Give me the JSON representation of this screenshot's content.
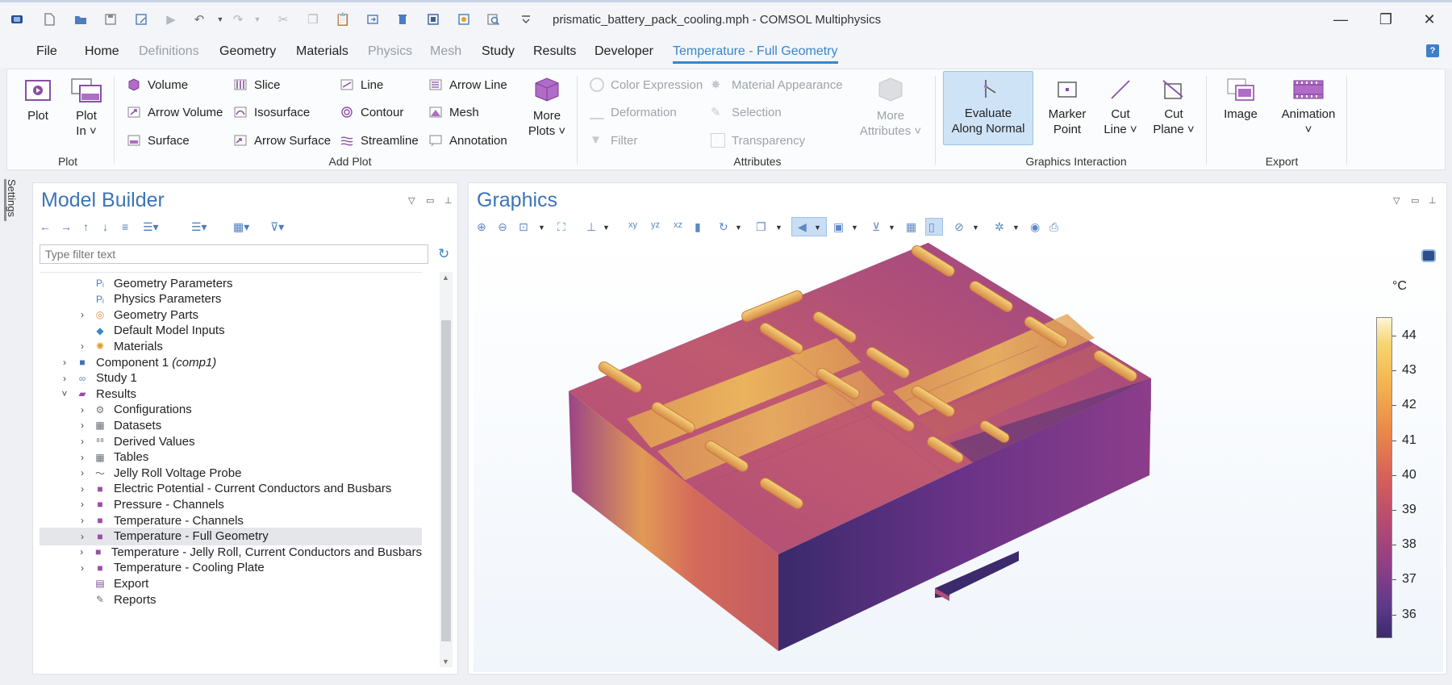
{
  "titlebar": {
    "title": "prismatic_battery_pack_cooling.mph - COMSOL Multiphysics",
    "quick_access": [
      "app-icon",
      "new-icon",
      "open-icon",
      "save-icon",
      "save-as-icon",
      "run-icon",
      "undo-icon",
      "redo-icon",
      "cut-icon",
      "copy-icon",
      "paste-icon",
      "duplicate-icon",
      "delete-icon",
      "select-icon",
      "wizard-icon",
      "find-icon",
      "customize-icon"
    ]
  },
  "menu": {
    "items": [
      {
        "label": "File",
        "state": "normal"
      },
      {
        "label": "Home",
        "state": "normal"
      },
      {
        "label": "Definitions",
        "state": "dim"
      },
      {
        "label": "Geometry",
        "state": "normal"
      },
      {
        "label": "Materials",
        "state": "normal"
      },
      {
        "label": "Physics",
        "state": "dim"
      },
      {
        "label": "Mesh",
        "state": "dim"
      },
      {
        "label": "Study",
        "state": "normal"
      },
      {
        "label": "Results",
        "state": "normal"
      },
      {
        "label": "Developer",
        "state": "normal"
      },
      {
        "label": "Temperature - Full Geometry",
        "state": "active"
      }
    ],
    "help": "?"
  },
  "ribbon": {
    "plot_group": {
      "label": "Plot",
      "plot": "Plot",
      "plot_in_1": "Plot",
      "plot_in_2": "In ˅"
    },
    "add_plot": {
      "label": "Add Plot",
      "col1": [
        "Volume",
        "Arrow Volume",
        "Surface"
      ],
      "col2": [
        "Slice",
        "Isosurface",
        "Arrow Surface"
      ],
      "col3": [
        "Line",
        "Contour",
        "Streamline"
      ],
      "col4": [
        "Arrow Line",
        "Mesh",
        "Annotation"
      ],
      "more_1": "More",
      "more_2": "Plots ˅"
    },
    "attributes": {
      "label": "Attributes",
      "col1": [
        "Color Expression",
        "Deformation",
        "Filter"
      ],
      "col2": [
        "Material Appearance",
        "Selection",
        "Transparency"
      ],
      "more_1": "More",
      "more_2": "Attributes ˅"
    },
    "graphics_interaction": {
      "label": "Graphics Interaction",
      "eval_1": "Evaluate",
      "eval_2": "Along Normal",
      "marker_1": "Marker",
      "marker_2": "Point",
      "cutline_1": "Cut",
      "cutline_2": "Line ˅",
      "cutplane_1": "Cut",
      "cutplane_2": "Plane ˅"
    },
    "export": {
      "label": "Export",
      "image": "Image",
      "animation": "Animation",
      "animation_caret": "˅"
    }
  },
  "settings_tab": "Settings",
  "model_builder": {
    "title": "Model Builder",
    "filter_placeholder": "Type filter text",
    "tree": [
      {
        "label": "Geometry Parameters",
        "italic": "",
        "level": 2,
        "expander": "",
        "icon": "parameters-icon",
        "selected": false
      },
      {
        "label": "Physics Parameters",
        "italic": "",
        "level": 2,
        "expander": "",
        "icon": "parameters-icon",
        "selected": false
      },
      {
        "label": "Geometry Parts",
        "italic": "",
        "level": 2,
        "expander": "›",
        "icon": "geometry-parts-icon",
        "selected": false
      },
      {
        "label": "Default Model Inputs",
        "italic": "",
        "level": 2,
        "expander": "",
        "icon": "model-inputs-icon",
        "selected": false
      },
      {
        "label": "Materials",
        "italic": "",
        "level": 2,
        "expander": "›",
        "icon": "materials-icon",
        "selected": false
      },
      {
        "label": "Component 1 ",
        "italic": "(comp1)",
        "level": 1,
        "expander": "›",
        "icon": "component-icon",
        "selected": false
      },
      {
        "label": "Study 1",
        "italic": "",
        "level": 1,
        "expander": "›",
        "icon": "study-icon",
        "selected": false
      },
      {
        "label": "Results",
        "italic": "",
        "level": 1,
        "expander": "˅",
        "icon": "results-icon",
        "selected": false
      },
      {
        "label": "Configurations",
        "italic": "",
        "level": 2,
        "expander": "›",
        "icon": "configurations-icon",
        "selected": false
      },
      {
        "label": "Datasets",
        "italic": "",
        "level": 2,
        "expander": "›",
        "icon": "datasets-icon",
        "selected": false
      },
      {
        "label": "Derived Values",
        "italic": "",
        "level": 2,
        "expander": "›",
        "icon": "derived-values-icon",
        "selected": false
      },
      {
        "label": "Tables",
        "italic": "",
        "level": 2,
        "expander": "›",
        "icon": "tables-icon",
        "selected": false
      },
      {
        "label": "Jelly Roll Voltage Probe",
        "italic": "",
        "level": 2,
        "expander": "›",
        "icon": "probe-plot-icon",
        "selected": false
      },
      {
        "label": "Electric Potential - Current Conductors and Busbars",
        "italic": "",
        "level": 2,
        "expander": "›",
        "icon": "plot-group-3d-icon",
        "selected": false
      },
      {
        "label": "Pressure - Channels",
        "italic": "",
        "level": 2,
        "expander": "›",
        "icon": "plot-group-3d-icon",
        "selected": false
      },
      {
        "label": "Temperature - Channels",
        "italic": "",
        "level": 2,
        "expander": "›",
        "icon": "plot-group-3d-icon",
        "selected": false
      },
      {
        "label": "Temperature - Full Geometry",
        "italic": "",
        "level": 2,
        "expander": "›",
        "icon": "plot-group-3d-icon",
        "selected": true
      },
      {
        "label": "Temperature - Jelly Roll, Current Conductors and Busbars",
        "italic": "",
        "level": 2,
        "expander": "›",
        "icon": "plot-group-3d-icon",
        "selected": false
      },
      {
        "label": "Temperature - Cooling Plate",
        "italic": "",
        "level": 2,
        "expander": "›",
        "icon": "plot-group-3d-icon",
        "selected": false
      },
      {
        "label": "Export",
        "italic": "",
        "level": 2,
        "expander": "",
        "icon": "export-icon",
        "selected": false
      },
      {
        "label": "Reports",
        "italic": "",
        "level": 2,
        "expander": "",
        "icon": "reports-icon",
        "selected": false
      }
    ]
  },
  "graphics": {
    "title": "Graphics",
    "unit": "°C",
    "colorbar_ticks": [
      "44",
      "43",
      "42",
      "41",
      "40",
      "39",
      "38",
      "37",
      "36"
    ],
    "colors": {
      "hot": "#f6d672",
      "mid": "#d6605a",
      "cool": "#3b2a6e",
      "accent": "#3a86c8"
    }
  }
}
